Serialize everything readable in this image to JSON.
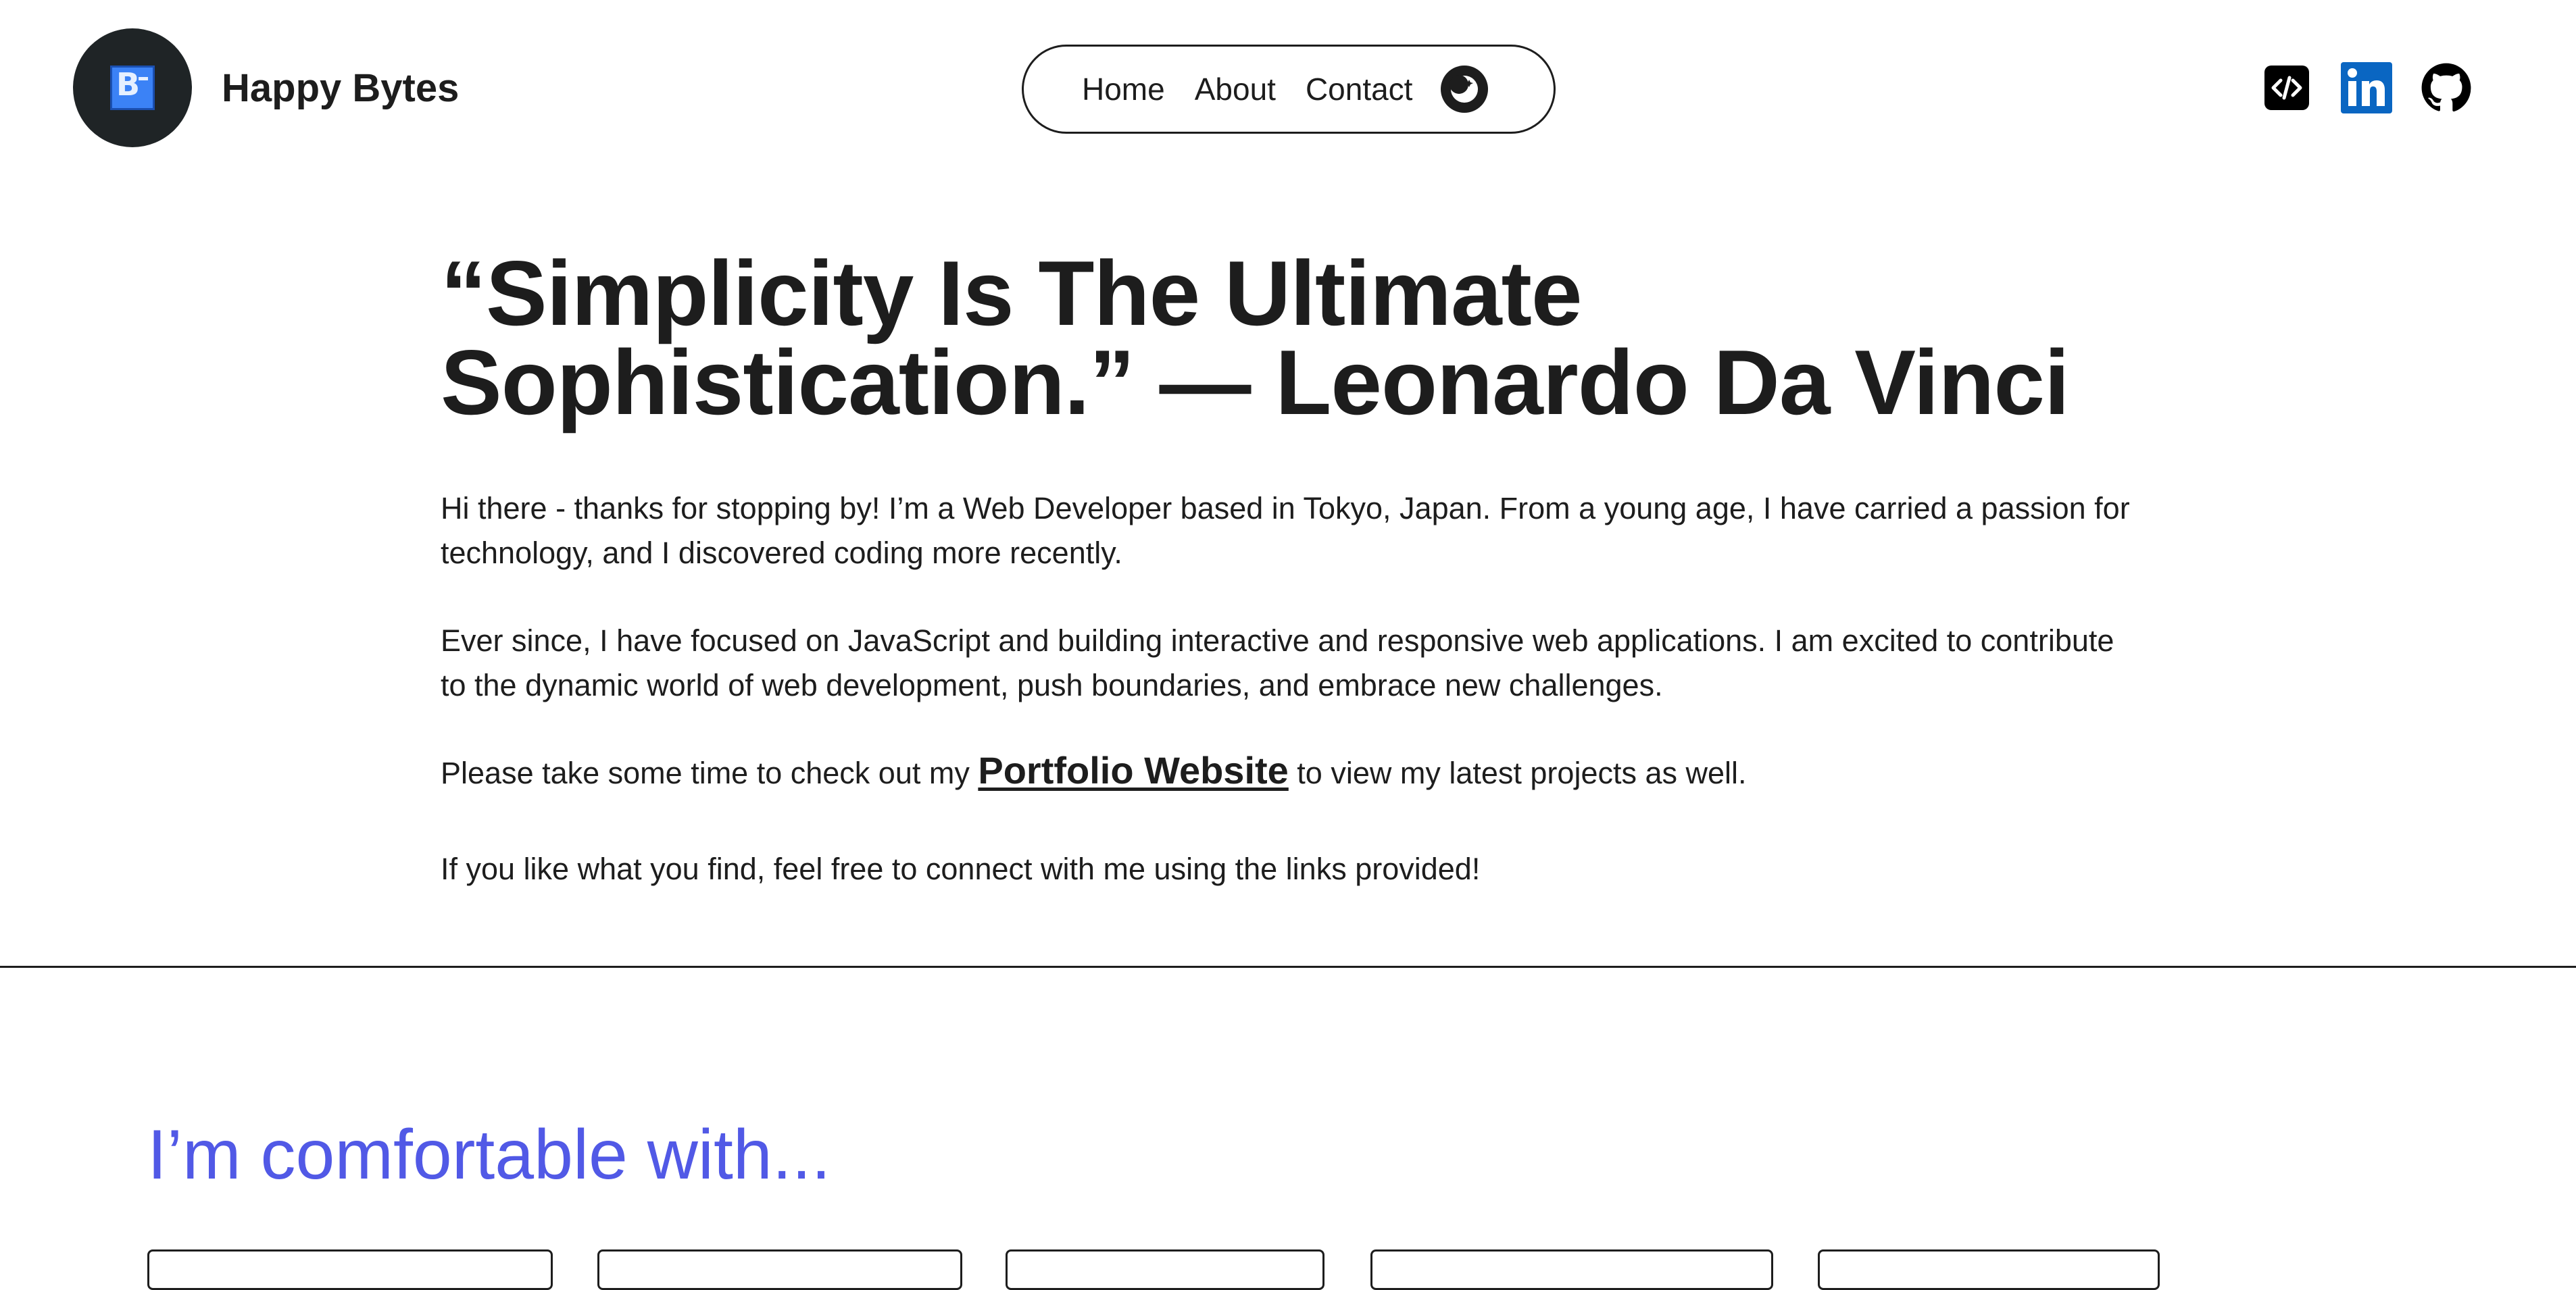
{
  "brand": {
    "name": "Happy Bytes",
    "logo_text": "B",
    "logo_color": "#3b82f6",
    "avatar_bg": "#1f2426"
  },
  "nav": {
    "links": [
      "Home",
      "About",
      "Contact"
    ],
    "theme_toggle_icon": "moon-icon"
  },
  "social": {
    "icons": [
      "dev-icon",
      "linkedin-icon",
      "github-icon"
    ],
    "linkedin_color": "#0a66c2"
  },
  "hero": {
    "quote_line1": "“Simplicity Is The Ultimate",
    "quote_line2": "Sophistication.” — Leonardo Da Vinci",
    "paragraph1": "Hi there - thanks for stopping by! I’m a Web Developer based in Tokyo, Japan. From a young age, I have carried a passion for technology, and I discovered coding more recently.",
    "paragraph2": "Ever since, I have focused on JavaScript and building interactive and responsive web applications. I am excited to contribute to the dynamic world of web development, push boundaries, and embrace new challenges.",
    "paragraph3_before": "Please take some time to check out my ",
    "paragraph3_link": "Portfolio Website",
    "paragraph3_after": " to view my latest projects as well.",
    "paragraph4": "If you like what you find, feel free to connect with me using the links provided!"
  },
  "skills": {
    "heading": "I’m comfortable with...",
    "heading_color": "#5159e6"
  }
}
